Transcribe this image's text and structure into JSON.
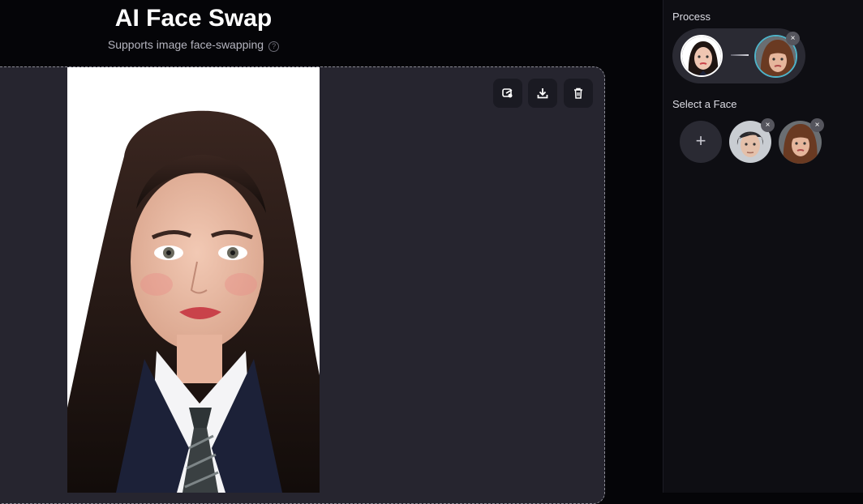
{
  "header": {
    "title": "AI Face Swap",
    "subtitle": "Supports image face-swapping",
    "help_icon": "?"
  },
  "toolbar": {
    "icons": [
      "edit-icon",
      "download-icon",
      "trash-icon"
    ]
  },
  "sidebar": {
    "process_label": "Process",
    "select_face_label": "Select a Face",
    "add_face_symbol": "+",
    "close_symbol": "×",
    "faces": [
      {
        "name": "dark-haired-man-face"
      },
      {
        "name": "curly-haired-woman-face"
      }
    ]
  },
  "colors": {
    "background": "#050508",
    "sidebar": "#0e0e13",
    "canvas": "#26252f",
    "accent_ring": "#4fb3c8"
  }
}
